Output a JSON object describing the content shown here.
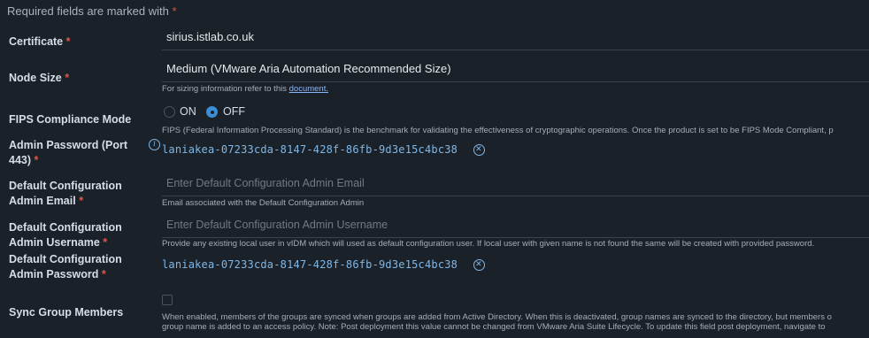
{
  "top_note": "Required fields are marked with",
  "required_mark": "*",
  "certificate": {
    "label": "Certificate",
    "value": "sirius.istlab.co.uk"
  },
  "node_size": {
    "label": "Node Size",
    "value": "Medium (VMware Aria Automation Recommended Size)",
    "helper_prefix": "For sizing information refer to this",
    "helper_link": "document.",
    "helper_suffix": ""
  },
  "fips": {
    "label": "FIPS Compliance Mode",
    "on_label": "ON",
    "off_label": "OFF",
    "selected": "OFF",
    "helper": "FIPS (Federal Information Processing Standard) is the benchmark for validating the effectiveness of cryptographic operations. Once the product is set to be FIPS Mode Compliant, p"
  },
  "admin_password": {
    "label_line1": "Admin Password (Port",
    "label_line2": "443)",
    "value": "laniakea-07233cda-8147-428f-86fb-9d3e15c4bc38",
    "info_icon": "info-icon",
    "clear_icon": "clear-icon"
  },
  "default_admin_email": {
    "label_line1": "Default Configuration",
    "label_line2": "Admin Email",
    "placeholder": "Enter Default Configuration Admin Email",
    "helper": "Email associated with the Default Configuration Admin"
  },
  "default_admin_username": {
    "label_line1": "Default Configuration",
    "label_line2": "Admin Username",
    "placeholder": "Enter Default Configuration Admin Username",
    "helper": "Provide any existing local user in vIDM which will used as default configuration user. If local user with given name is not found the same will be created with provided password."
  },
  "default_admin_password": {
    "label_line1": "Default Configuration",
    "label_line2": "Admin Password",
    "value": "laniakea-07233cda-8147-428f-86fb-9d3e15c4bc38"
  },
  "sync_group_members": {
    "label": "Sync Group Members",
    "helper_line1": "When enabled, members of the groups are synced when groups are added from Active Directory. When this is deactivated, group names are synced to the directory, but members o",
    "helper_line2": "group name is added to an access policy. Note: Post deployment this value cannot be changed from VMware Aria Suite Lifecycle. To update this field post deployment, navigate to"
  }
}
